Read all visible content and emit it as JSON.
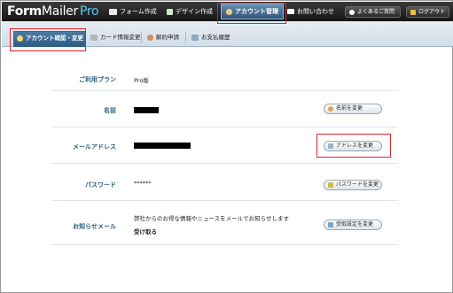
{
  "header": {
    "logo_main": "Form",
    "logo_mid": "Mailer",
    "logo_pro": "Pro",
    "nav": [
      {
        "label": "フォーム作成",
        "icon": "form-icon"
      },
      {
        "label": "デザイン作成",
        "icon": "design-icon"
      },
      {
        "label": "アカウント管理",
        "icon": "account-icon",
        "active": true
      },
      {
        "label": "お問い合わせ",
        "icon": "mail-icon"
      }
    ],
    "faq_label": "よくあるご質問",
    "logout_label": "ログアウト"
  },
  "subnav": {
    "tabs": [
      {
        "label": "アカウント確認・変更",
        "active": true
      },
      {
        "label": "カード情報変更"
      },
      {
        "label": "解約申請"
      },
      {
        "label": "お支払履歴"
      }
    ]
  },
  "account": {
    "plan": {
      "label": "ご利用プラン",
      "value": "Pro版"
    },
    "name": {
      "label": "名前",
      "button": "名前を変更"
    },
    "email": {
      "label": "メールアドレス",
      "button": "アドレスを変更"
    },
    "password": {
      "label": "パスワード",
      "value": "******",
      "button": "パスワードを変更"
    },
    "notify": {
      "label": "お知らせメール",
      "description": "弊社からのお得な情報やニュースをメールでお知らせします",
      "status": "受け取る",
      "button": "受取設定を変更"
    }
  },
  "colors": {
    "header_bg": "#1f1f1f",
    "active_tab": "#2c5a86",
    "label_text": "#2b5e7d",
    "highlight": "#e0262d"
  }
}
